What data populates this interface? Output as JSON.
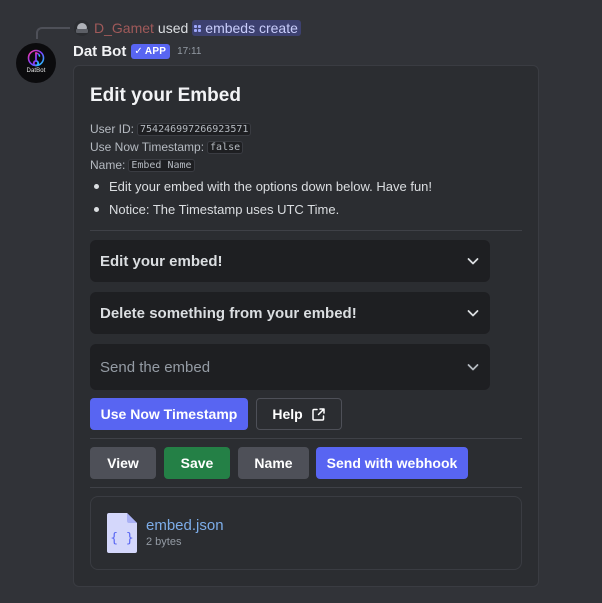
{
  "reply": {
    "username": "D_Gamet",
    "used_text": "used",
    "command": "embeds create",
    "username_color": "#a05a5a"
  },
  "bot": {
    "avatar_text": "DatBot",
    "name": "Dat Bot",
    "tag": "APP",
    "tag_icon": "checkmark-icon",
    "timestamp": "17:11"
  },
  "embed": {
    "title": "Edit your Embed",
    "fields": [
      {
        "label": "User ID:",
        "value": "754246997266923571"
      },
      {
        "label": "Use Now Timestamp:",
        "value": "false"
      },
      {
        "label": "Name:",
        "value": "Embed Name"
      }
    ],
    "bullets": [
      "Edit your embed with the options down below. Have fun!",
      "Notice: The Timestamp uses UTC Time."
    ]
  },
  "selects": [
    {
      "label": "Edit your embed!",
      "placeholder": false
    },
    {
      "label": "Delete something from your embed!",
      "placeholder": false
    },
    {
      "label": "Send the embed",
      "placeholder": true
    }
  ],
  "buttons": {
    "use_now_timestamp": "Use Now Timestamp",
    "help": "Help",
    "view": "View",
    "save": "Save",
    "name": "Name",
    "send_with_webhook": "Send with webhook"
  },
  "attachment": {
    "filename": "embed.json",
    "size": "2 bytes",
    "icon": "json-file-icon"
  },
  "colors": {
    "background": "#313338",
    "embed_bg": "#2b2d31",
    "blurple": "#5865f2",
    "success": "#248046",
    "secondary": "#4e5058",
    "link": "#7dade9"
  }
}
